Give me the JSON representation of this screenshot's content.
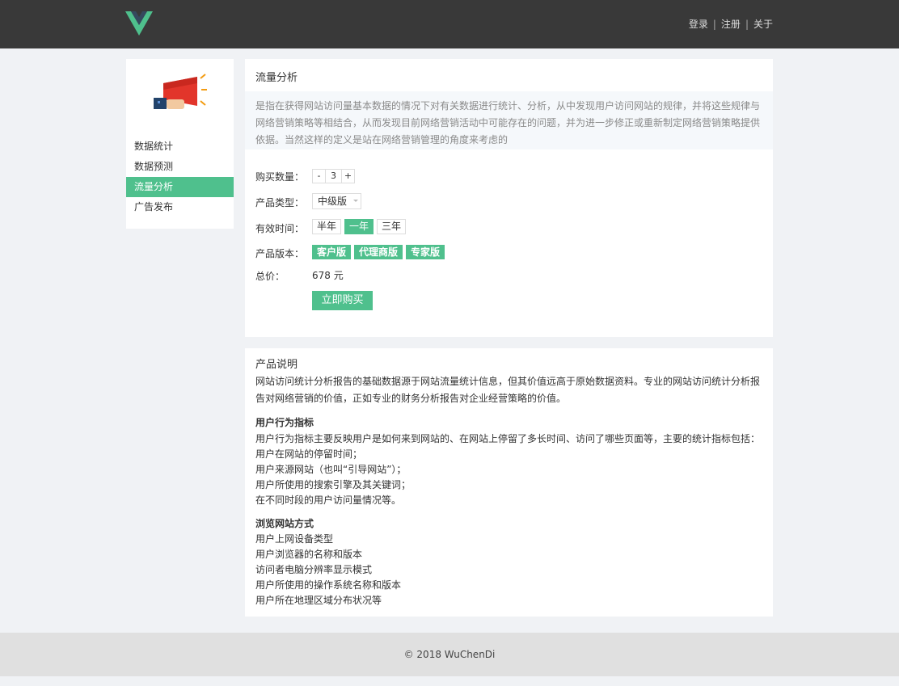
{
  "header": {
    "nav": [
      "登录",
      "注册",
      "关于"
    ],
    "separator": "|",
    "brand_color": "#4fc08d",
    "logo_icon": "vue-logo-icon"
  },
  "sidebar": {
    "illustration_icon": "megaphone-icon",
    "items": [
      {
        "label": "数据统计",
        "active": false
      },
      {
        "label": "数据预测",
        "active": false
      },
      {
        "label": "流量分析",
        "active": true
      },
      {
        "label": "广告发布",
        "active": false
      }
    ]
  },
  "main": {
    "title": "流量分析",
    "description": "是指在获得网站访问量基本数据的情况下对有关数据进行统计、分析，从中发现用户访问网站的规律，并将这些规律与网络营销策略等相结合，从而发现目前网络营销活动中可能存在的问题，并为进一步修正或重新制定网络营销策略提供依据。当然这样的定义是站在网络营销管理的角度来考虑的",
    "form": {
      "quantity_label": "购买数量：",
      "quantity": {
        "minus": "-",
        "value": "3",
        "plus": "+"
      },
      "type_label": "产品类型：",
      "type_selected": "中级版",
      "time_label": "有效时间：",
      "time_options": [
        {
          "label": "半年",
          "active": false
        },
        {
          "label": "一年",
          "active": true
        },
        {
          "label": "三年",
          "active": false
        }
      ],
      "version_label": "产品版本：",
      "version_options": [
        "客户版",
        "代理商版",
        "专家版"
      ],
      "total_label": "总价：",
      "total_value": "678 元",
      "buy_button": "立即购买"
    }
  },
  "info": {
    "title": "产品说明",
    "intro": "网站访问统计分析报告的基础数据源于网站流量统计信息，但其价值远高于原始数据资料。专业的网站访问统计分析报告对网络营销的价值，正如专业的财务分析报告对企业经营策略的价值。",
    "section1": {
      "heading": "用户行为指标",
      "lines": [
        "用户行为指标主要反映用户是如何来到网站的、在网站上停留了多长时间、访问了哪些页面等，主要的统计指标包括：",
        "用户在网站的停留时间；",
        "用户来源网站（也叫“引导网站”）；",
        "用户所使用的搜索引擎及其关键词；",
        "在不同时段的用户访问量情况等。"
      ]
    },
    "section2": {
      "heading": "浏览网站方式",
      "lines": [
        "用户上网设备类型",
        "用户浏览器的名称和版本",
        "访问者电脑分辨率显示模式",
        "用户所使用的操作系统名称和版本",
        "用户所在地理区域分布状况等"
      ]
    }
  },
  "footer": {
    "text": "© 2018 WuChenDi"
  }
}
